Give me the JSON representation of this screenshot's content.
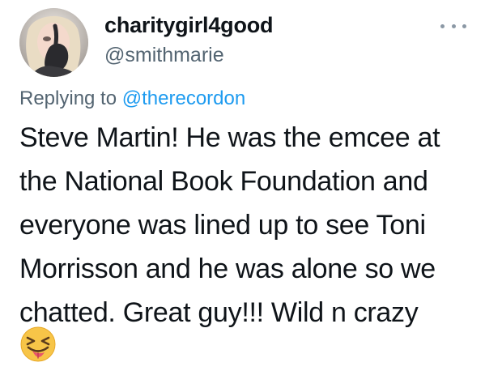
{
  "tweet": {
    "display_name": "charitygirl4good",
    "handle": "@smithmarie",
    "replying_prefix": "Replying to ",
    "replying_to": "@therecordon",
    "text_lines": [
      "Steve Martin! He was the emcee at",
      "the National Book Foundation and",
      "everyone was lined up to see Toni",
      "Morrisson and he was alone so we",
      "chatted. Great guy!!! Wild n crazy"
    ],
    "emoji": "squinting-face-with-tongue"
  },
  "icons": {
    "more": "more-horizontal-icon",
    "avatar": "user-avatar"
  },
  "colors": {
    "text": "#0f1419",
    "secondary": "#536471",
    "link": "#1d9bf0",
    "emoji_face": "#f7c548"
  }
}
